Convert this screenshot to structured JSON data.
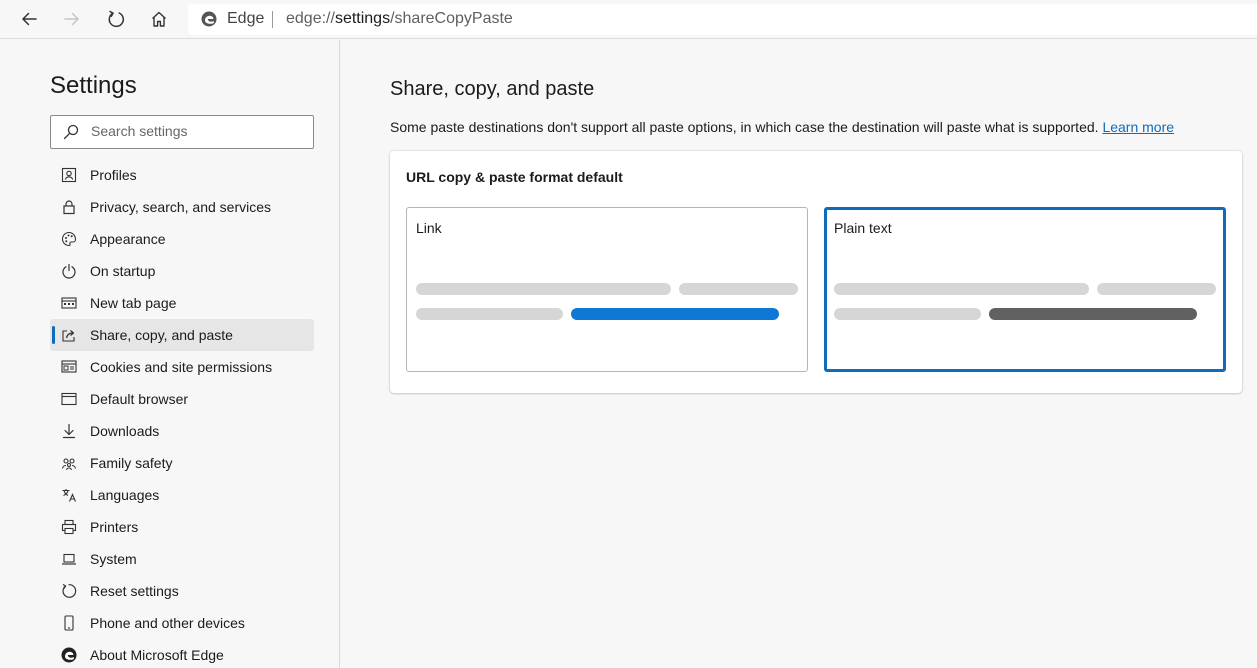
{
  "toolbar": {
    "icons": [
      "back-arrow-icon",
      "forward-arrow-icon",
      "refresh-icon",
      "home-icon"
    ],
    "site_label": "Edge",
    "url_scheme": "edge://",
    "url_host": "settings",
    "url_path": "/shareCopyPaste"
  },
  "sidebar": {
    "title": "Settings",
    "search_placeholder": "Search settings",
    "items": [
      {
        "label": "Profiles",
        "icon": "profile-icon"
      },
      {
        "label": "Privacy, search, and services",
        "icon": "lock-icon"
      },
      {
        "label": "Appearance",
        "icon": "palette-icon"
      },
      {
        "label": "On startup",
        "icon": "power-icon"
      },
      {
        "label": "New tab page",
        "icon": "new-tab-icon"
      },
      {
        "label": "Share, copy, and paste",
        "icon": "share-icon",
        "active": true
      },
      {
        "label": "Cookies and site permissions",
        "icon": "cookies-icon"
      },
      {
        "label": "Default browser",
        "icon": "browser-icon"
      },
      {
        "label": "Downloads",
        "icon": "download-icon"
      },
      {
        "label": "Family safety",
        "icon": "family-icon"
      },
      {
        "label": "Languages",
        "icon": "languages-icon"
      },
      {
        "label": "Printers",
        "icon": "printer-icon"
      },
      {
        "label": "System",
        "icon": "laptop-icon"
      },
      {
        "label": "Reset settings",
        "icon": "reset-icon"
      },
      {
        "label": "Phone and other devices",
        "icon": "phone-icon"
      },
      {
        "label": "About Microsoft Edge",
        "icon": "edge-logo-icon"
      }
    ]
  },
  "main": {
    "title": "Share, copy, and paste",
    "description": "Some paste destinations don't support all paste options, in which case the destination will paste what is supported.",
    "learn_more": "Learn more",
    "card": {
      "title": "URL copy & paste format default",
      "options": [
        {
          "label": "Link",
          "selected": false
        },
        {
          "label": "Plain text",
          "selected": true
        }
      ]
    }
  },
  "colors": {
    "accent": "#0f6cbd",
    "link_preview_bar": "#0f78d4",
    "plaintext_preview_bar": "#616161",
    "placeholder_bar": "#d6d6d6"
  }
}
